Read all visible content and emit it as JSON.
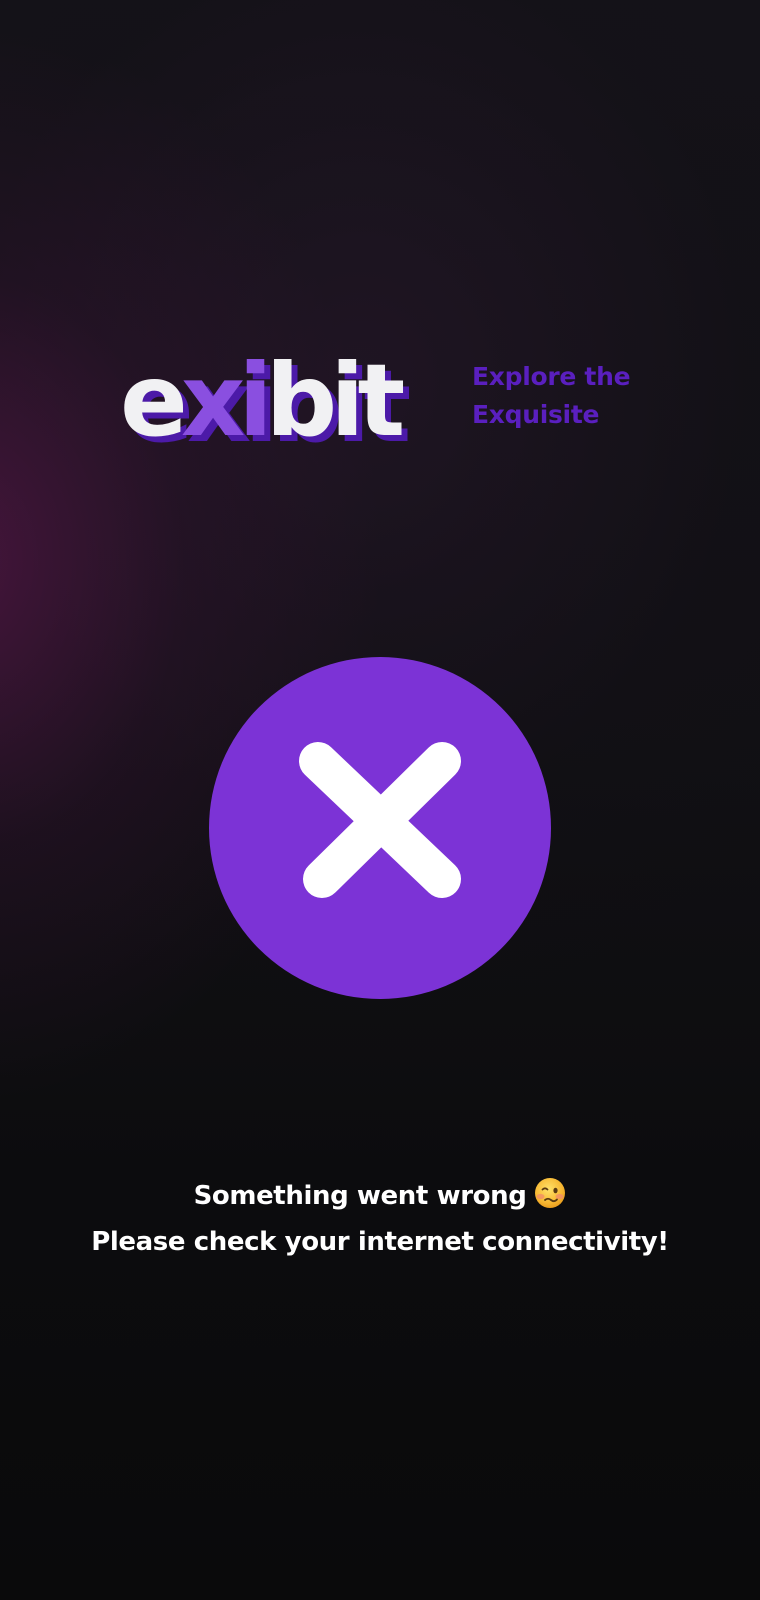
{
  "app": {
    "logo_text": "exibit",
    "tagline_line1": "Explore the",
    "tagline_line2": "Exquisite"
  },
  "error": {
    "icon": "close-icon",
    "title": "Something went wrong",
    "title_emoji": "woozy-face-icon",
    "subtitle": "Please check your internet connectivity!"
  },
  "colors": {
    "accent": "#7c33d6",
    "tagline": "#5a1fbf",
    "logo_fill": "#f1f1f3",
    "background": "#0b0b0d",
    "text": "#ffffff"
  }
}
